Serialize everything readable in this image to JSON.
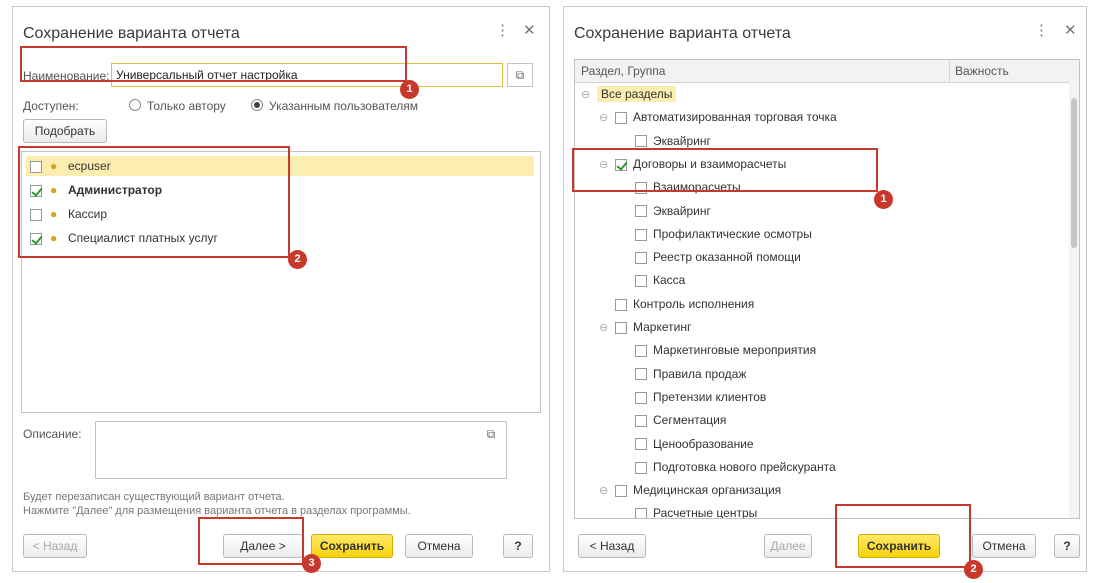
{
  "left": {
    "title": "Сохранение варианта отчета",
    "name_label": "Наименование:",
    "name_value": "Универсальный отчет настройка",
    "access_label": "Доступен:",
    "access_options": [
      "Только автору",
      "Указанным пользователям"
    ],
    "pick_button": "Подобрать",
    "users": [
      {
        "name": "ecpuser",
        "checked": false,
        "bold": false
      },
      {
        "name": "Администратор",
        "checked": true,
        "bold": true
      },
      {
        "name": "Кассир",
        "checked": false,
        "bold": false
      },
      {
        "name": "Специалист платных услуг",
        "checked": true,
        "bold": false
      }
    ],
    "description_label": "Описание:",
    "info_line1": "Будет перезаписан существующий вариант отчета.",
    "info_line2": "Нажмите \"Далее\" для размещения варианта отчета в разделах программы.",
    "buttons": {
      "back": "< Назад",
      "next": "Далее >",
      "save": "Сохранить",
      "cancel": "Отмена",
      "help": "?"
    }
  },
  "right": {
    "title": "Сохранение варианта отчета",
    "col_section": "Раздел, Группа",
    "col_importance": "Важность",
    "tree": [
      {
        "label": "Все разделы",
        "level": 0,
        "toggle": "⊖",
        "checkbox": false,
        "selected": true
      },
      {
        "label": "Автоматизированная торговая точка",
        "level": 1,
        "toggle": "⊖",
        "checkbox": true,
        "checked": false
      },
      {
        "label": "Эквайринг",
        "level": 2,
        "toggle": "",
        "checkbox": true,
        "checked": false
      },
      {
        "label": "Договоры и взаиморасчеты",
        "level": 1,
        "toggle": "⊖",
        "checkbox": true,
        "checked": true
      },
      {
        "label": "Взаиморасчеты",
        "level": 2,
        "toggle": "",
        "checkbox": true,
        "checked": false
      },
      {
        "label": "Эквайринг",
        "level": 2,
        "toggle": "",
        "checkbox": true,
        "checked": false
      },
      {
        "label": "Профилактические осмотры",
        "level": 2,
        "toggle": "",
        "checkbox": true,
        "checked": false
      },
      {
        "label": "Реестр оказанной помощи",
        "level": 2,
        "toggle": "",
        "checkbox": true,
        "checked": false
      },
      {
        "label": "Касса",
        "level": 2,
        "toggle": "",
        "checkbox": true,
        "checked": false
      },
      {
        "label": "Контроль исполнения",
        "level": 1,
        "toggle": "",
        "checkbox": true,
        "checked": false
      },
      {
        "label": "Маркетинг",
        "level": 1,
        "toggle": "⊖",
        "checkbox": true,
        "checked": false
      },
      {
        "label": "Маркетинговые мероприятия",
        "level": 2,
        "toggle": "",
        "checkbox": true,
        "checked": false
      },
      {
        "label": "Правила продаж",
        "level": 2,
        "toggle": "",
        "checkbox": true,
        "checked": false
      },
      {
        "label": "Претензии клиентов",
        "level": 2,
        "toggle": "",
        "checkbox": true,
        "checked": false
      },
      {
        "label": "Сегментация",
        "level": 2,
        "toggle": "",
        "checkbox": true,
        "checked": false
      },
      {
        "label": "Ценообразование",
        "level": 2,
        "toggle": "",
        "checkbox": true,
        "checked": false
      },
      {
        "label": "Подготовка нового прейскуранта",
        "level": 2,
        "toggle": "",
        "checkbox": true,
        "checked": false
      },
      {
        "label": "Медицинская организация",
        "level": 1,
        "toggle": "⊖",
        "checkbox": true,
        "checked": false
      },
      {
        "label": "Расчетные центры",
        "level": 2,
        "toggle": "",
        "checkbox": true,
        "checked": false
      }
    ],
    "buttons": {
      "back": "< Назад",
      "next": "Далее",
      "save": "Сохранить",
      "cancel": "Отмена",
      "help": "?"
    }
  },
  "badges": {
    "b1": "1",
    "b2": "2",
    "b3": "3",
    "r1": "1",
    "r2": "2"
  },
  "icons": {
    "more": "⋮",
    "close": "✕",
    "copy": "⧉",
    "user": "user-icon"
  },
  "colors": {
    "highlight": "#c7392b",
    "primary_button": "#f8d20a",
    "selection": "#fbeeb0",
    "checkmark": "#2a9a2a"
  }
}
